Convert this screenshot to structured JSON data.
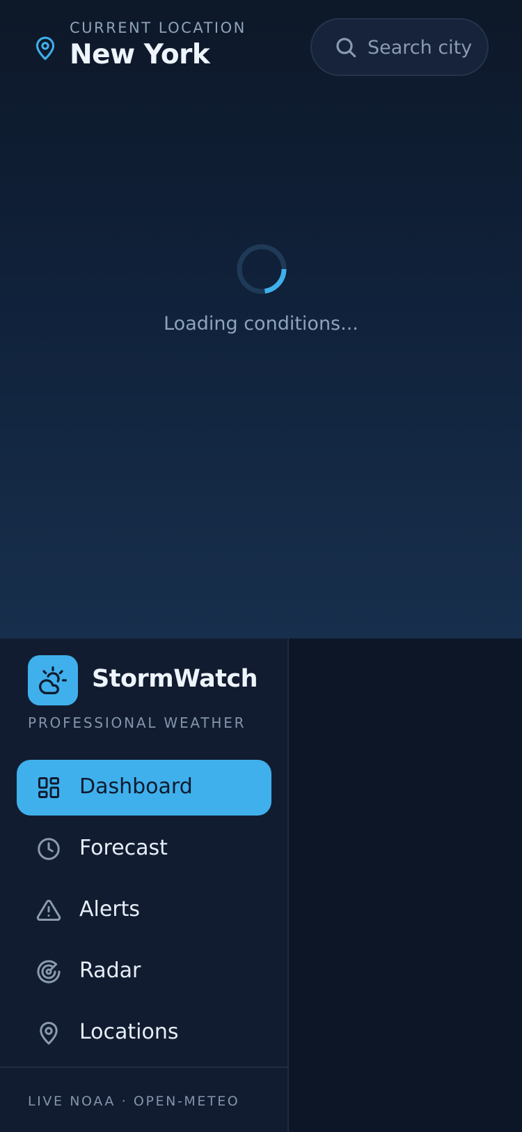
{
  "header": {
    "location_caption": "CURRENT LOCATION",
    "city": "New York",
    "search": {
      "placeholder": "Search city"
    }
  },
  "status": {
    "loading_text": "Loading conditions..."
  },
  "sidebar": {
    "brand": {
      "name": "StormWatch",
      "tagline": "PROFESSIONAL WEATHER"
    },
    "nav": [
      {
        "label": "Dashboard",
        "icon": "dashboard-icon",
        "active": true
      },
      {
        "label": "Forecast",
        "icon": "clock-icon",
        "active": false
      },
      {
        "label": "Alerts",
        "icon": "warning-icon",
        "active": false
      },
      {
        "label": "Radar",
        "icon": "radar-icon",
        "active": false
      },
      {
        "label": "Locations",
        "icon": "map-pin-icon",
        "active": false
      }
    ],
    "footer": "LIVE NOAA · OPEN-METEO"
  },
  "colors": {
    "accent": "#3fb0ec",
    "background": "#0d1627",
    "sidebar": "#121c30",
    "text_primary": "#eef4fb",
    "text_muted": "#8fa3ba"
  }
}
